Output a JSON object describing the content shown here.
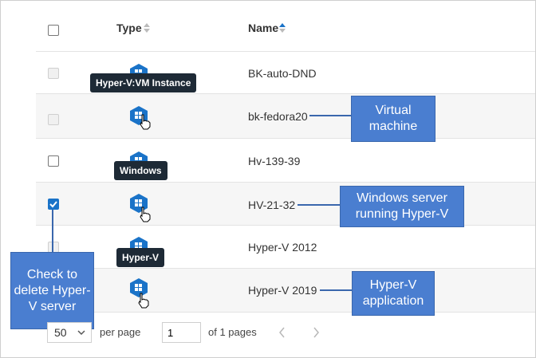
{
  "header": {
    "type_label": "Type",
    "name_label": "Name"
  },
  "rows": [
    {
      "name": "BK-auto-DND",
      "checked": false,
      "disabled": true
    },
    {
      "name": "bk-fedora20",
      "checked": false,
      "disabled": true
    },
    {
      "name": "Hv-139-39",
      "checked": false,
      "disabled": false
    },
    {
      "name": "HV-21-32",
      "checked": true,
      "disabled": false
    },
    {
      "name": "Hyper-V 2012",
      "checked": false,
      "disabled": true
    },
    {
      "name": "Hyper-V 2019",
      "checked": false,
      "disabled": true
    }
  ],
  "tooltips": {
    "vm_instance": "Hyper-V:VM Instance",
    "windows": "Windows",
    "hyperv": "Hyper-V"
  },
  "callouts": {
    "virtual_machine": "Virtual machine",
    "windows_server": "Windows server running Hyper-V",
    "hyperv_app": "Hyper-V application",
    "check_delete": "Check to delete Hyper-V server"
  },
  "pagination": {
    "page_size": "50",
    "per_page_label": "per page",
    "current_page": "1",
    "of_pages_label": "of 1 pages"
  },
  "colors": {
    "accent": "#1a73c8",
    "callout": "#4a7ed0",
    "tooltip": "#1e2a36"
  }
}
